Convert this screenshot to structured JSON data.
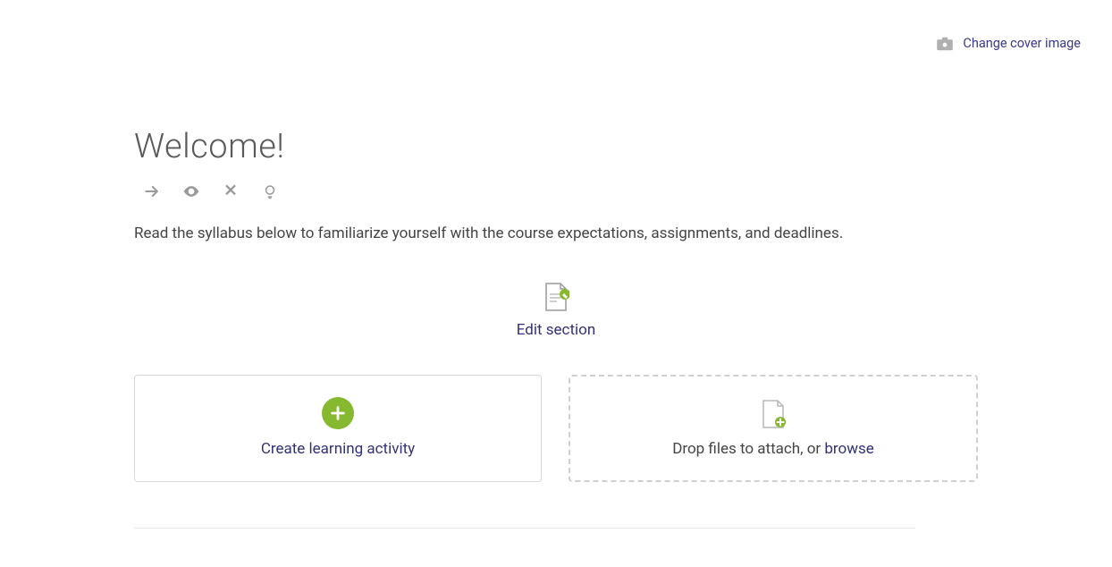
{
  "cover": {
    "change_label": "Change cover image"
  },
  "page": {
    "title": "Welcome!",
    "description": "Read the syllabus below to familiarize yourself with the course expectations, assignments, and deadlines."
  },
  "edit_section": {
    "label": "Edit section"
  },
  "cards": {
    "create_label": "Create learning activity",
    "drop_prefix": "Drop files to attach, or ",
    "drop_browse": "browse"
  },
  "colors": {
    "accent_green": "#86b92f",
    "link_purple": "#32327a"
  }
}
